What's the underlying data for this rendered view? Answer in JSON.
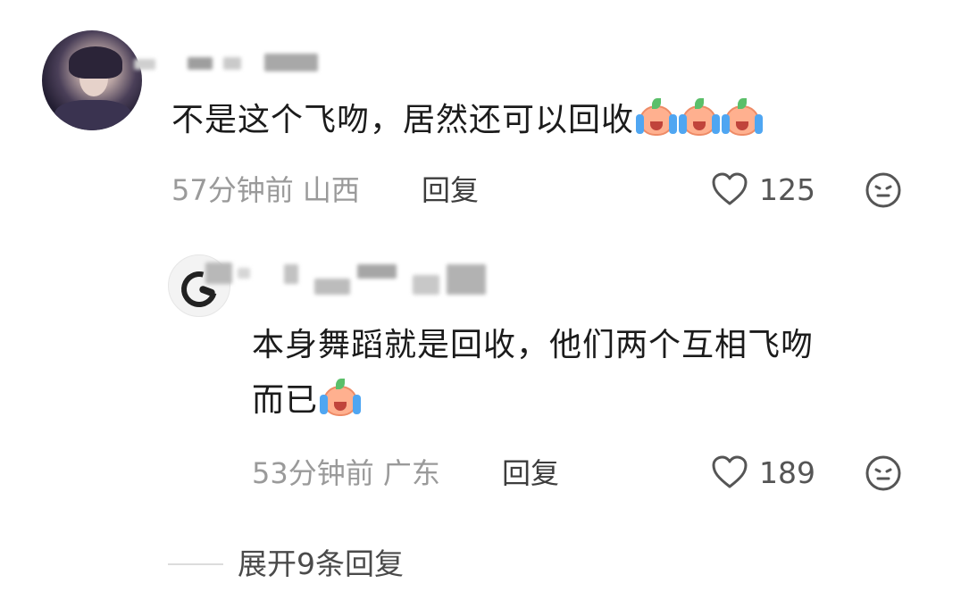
{
  "comments": [
    {
      "text": "不是这个飞吻，居然还可以回收",
      "emoji_count": 3,
      "time": "57分钟前",
      "location": "山西",
      "reply_label": "回复",
      "likes": "125",
      "icons": {
        "like": "heart-outline-icon",
        "react": "neutral-face-icon"
      }
    }
  ],
  "reply": {
    "text_line1": "本身舞蹈就是回收，他们两个互相飞吻",
    "text_line2": "而已",
    "emoji_count": 1,
    "time": "53分钟前",
    "location": "广东",
    "reply_label": "回复",
    "likes": "189",
    "icons": {
      "like": "heart-outline-icon",
      "react": "neutral-face-icon"
    }
  },
  "expand": {
    "label": "展开9条回复"
  },
  "colors": {
    "meta_gray": "#9a9a9a",
    "text_dark": "#1b1b1b",
    "background": "#ffffff",
    "emoji_peach": "#ffb08f",
    "tear_blue": "#4fa6f2"
  }
}
